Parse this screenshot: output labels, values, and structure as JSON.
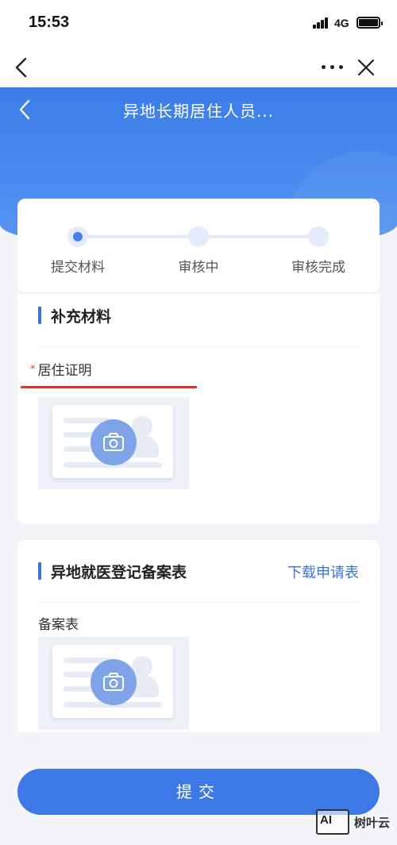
{
  "status_bar": {
    "time": "15:53",
    "network": "4G"
  },
  "hero": {
    "title": "异地长期居住人员..."
  },
  "steps": [
    {
      "label": "提交材料",
      "active": true
    },
    {
      "label": "审核中",
      "active": false
    },
    {
      "label": "审核完成",
      "active": false
    }
  ],
  "section1": {
    "title": "补充材料",
    "field_label": "居住证明",
    "required_mark": "*"
  },
  "section2": {
    "title": "异地就医登记备案表",
    "download_link": "下载申请表",
    "field_label": "备案表"
  },
  "submit_label": "提交",
  "watermark": {
    "logo_text": "AI",
    "text": "树叶云"
  },
  "colors": {
    "primary": "#3d79e6",
    "required": "#e0453a",
    "underline": "#d8352b"
  }
}
